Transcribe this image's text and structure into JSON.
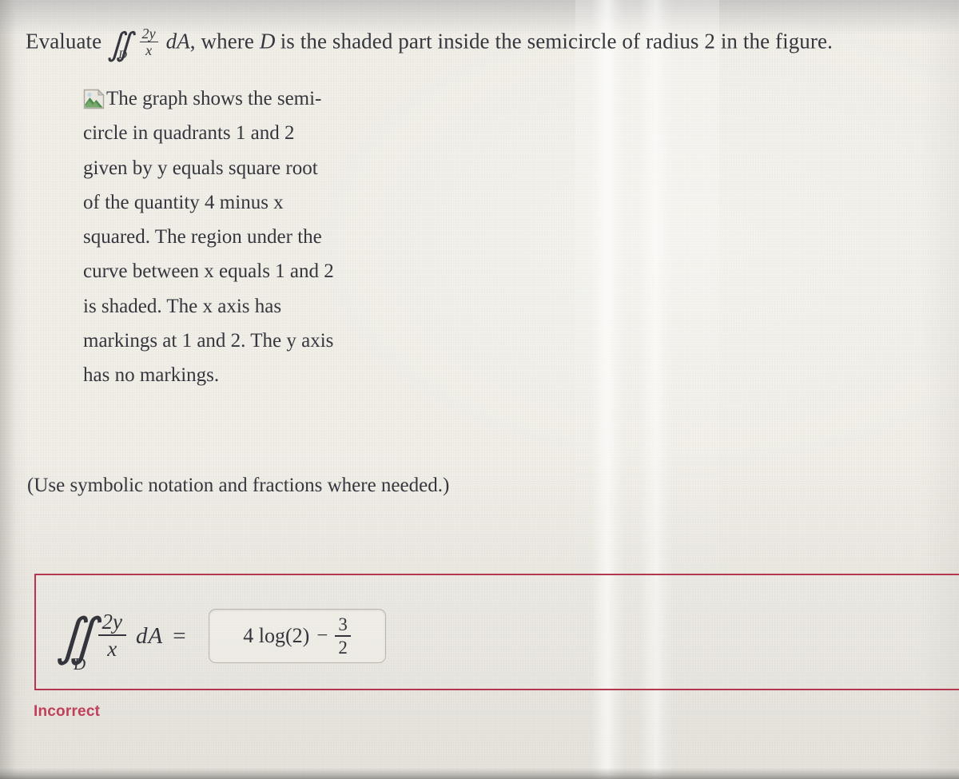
{
  "colors": {
    "paper": "#f1efe8",
    "text": "#35363e",
    "card_border": "#b2374f",
    "status": "#c0405c",
    "input_border": "#b9b6ad"
  },
  "prompt": {
    "lead": "Evaluate",
    "integral": {
      "symbol": "∬",
      "subscript": "D",
      "numerator": "2y",
      "denominator": "x",
      "differential": "dA"
    },
    "after_integral": ", where",
    "domain_symbol": "D",
    "tail": "is the shaded part inside the semicircle of radius 2 in the figure."
  },
  "figure": {
    "icon": "broken-image-icon",
    "alt_text": "The graph shows the semi-circle in quadrants 1 and 2 given by y equals square root of the quantity 4 minus x squared. The region under the curve between x equals 1 and 2 is shaded. The x axis has markings at 1 and 2. The y axis has no markings."
  },
  "instruction": "(Use symbolic notation and fractions where needed.)",
  "answer_area": {
    "lhs": {
      "symbol": "∬",
      "subscript": "D",
      "numerator": "2y",
      "denominator": "x",
      "differential": "dA",
      "equals": "="
    },
    "input": {
      "value_display": "4 log(2) − 3/2",
      "term1": "4 log(2)",
      "operator": "−",
      "frac_num": "3",
      "frac_den": "2",
      "placeholder": ""
    }
  },
  "status": {
    "label": "Incorrect"
  }
}
